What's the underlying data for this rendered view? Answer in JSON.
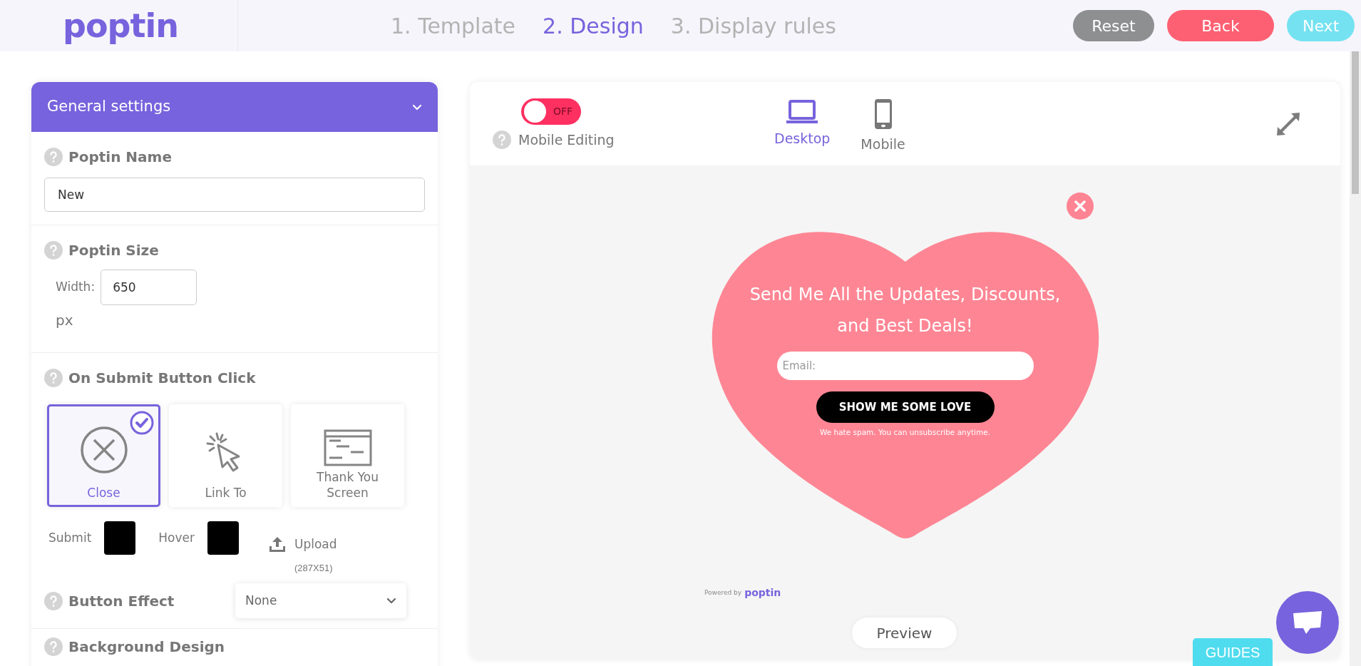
{
  "header": {
    "logo": "poptin",
    "steps": [
      {
        "label": "1. Template",
        "selected": false
      },
      {
        "label": "2. Design",
        "selected": true
      },
      {
        "label": "3. Display rules",
        "selected": false
      }
    ],
    "buttons": [
      {
        "label": "Reset",
        "kind": "reset"
      },
      {
        "label": "Back",
        "kind": "back"
      },
      {
        "label": "Next",
        "kind": "next"
      }
    ]
  },
  "settings_panel": {
    "title": "General settings",
    "expanded": true,
    "poptin_name": {
      "label": "Poptin Name",
      "value": "New"
    },
    "poptin_size": {
      "label": "Poptin Size",
      "width_label": "Width:",
      "width_value": "650",
      "unit": "px"
    },
    "on_submit": {
      "label": "On Submit Button Click",
      "options": [
        {
          "label": "Close",
          "kind": "close",
          "selected": true
        },
        {
          "label": "Link To",
          "kind": "link",
          "selected": false
        },
        {
          "label": "Thank You Screen",
          "kind": "screen",
          "selected": false
        }
      ],
      "colors": [
        {
          "label": "Submit",
          "color": "#000000"
        },
        {
          "label": "Hover",
          "color": "#000000"
        }
      ],
      "upload": {
        "label": "Upload",
        "hint": "(287X51)"
      }
    },
    "button_effect": {
      "label": "Button Effect",
      "value": "None"
    },
    "next_section": {
      "label": "Background Design"
    }
  },
  "preview": {
    "mobile_editing": {
      "label": "Mobile Editing",
      "toggle_text": "OFF",
      "on": false
    },
    "devices": [
      {
        "label": "Desktop",
        "kind": "desktop",
        "selected": true
      },
      {
        "label": "Mobile",
        "kind": "mobile",
        "selected": false
      }
    ],
    "popup": {
      "headline": "Send Me All the Updates, Discounts, and Best Deals!",
      "email_placeholder": "Email:",
      "button": "SHOW ME SOME LOVE",
      "note": "We hate spam. You can unsubscribe anytime.",
      "powered_by": "Powered by",
      "powered_logo": "poptin"
    },
    "preview_button": "Preview",
    "guides": "GUIDES"
  }
}
